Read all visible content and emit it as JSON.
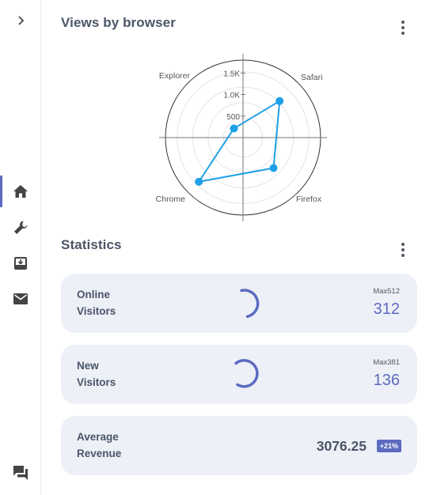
{
  "colors": {
    "accent": "#5c6bc0",
    "series": "#1ea0e6",
    "card_bg": "#edf0f7",
    "text": "#4a5568"
  },
  "sidebar": {
    "items": [
      {
        "name": "expand",
        "icon": "chevron-right-icon"
      },
      {
        "name": "home",
        "icon": "home-icon",
        "active": true
      },
      {
        "name": "tools",
        "icon": "wrench-icon"
      },
      {
        "name": "inbox",
        "icon": "inbox-download-icon"
      },
      {
        "name": "mail",
        "icon": "mail-icon"
      },
      {
        "name": "feedback",
        "icon": "chat-icon"
      }
    ]
  },
  "views_card": {
    "title": "Views by browser"
  },
  "chart_data": {
    "type": "radar",
    "categories": [
      "Safari",
      "Firefox",
      "Chrome",
      "Explorer"
    ],
    "values": [
      1200,
      1000,
      1450,
      300
    ],
    "radial_ticks": [
      "500",
      "1.0K",
      "1.5K"
    ],
    "rlim": [
      0,
      1800
    ],
    "grid": true
  },
  "stats_card": {
    "title": "Statistics",
    "online": {
      "label_line1": "Online",
      "label_line2": "Visitors",
      "max_label": "Max512",
      "value": "312"
    },
    "new": {
      "label_line1": "New",
      "label_line2": "Visitors",
      "max_label": "Max381",
      "value": "136"
    },
    "revenue": {
      "label_line1": "Average",
      "label_line2": "Revenue",
      "value": "3076.25",
      "badge": "+21%"
    }
  }
}
